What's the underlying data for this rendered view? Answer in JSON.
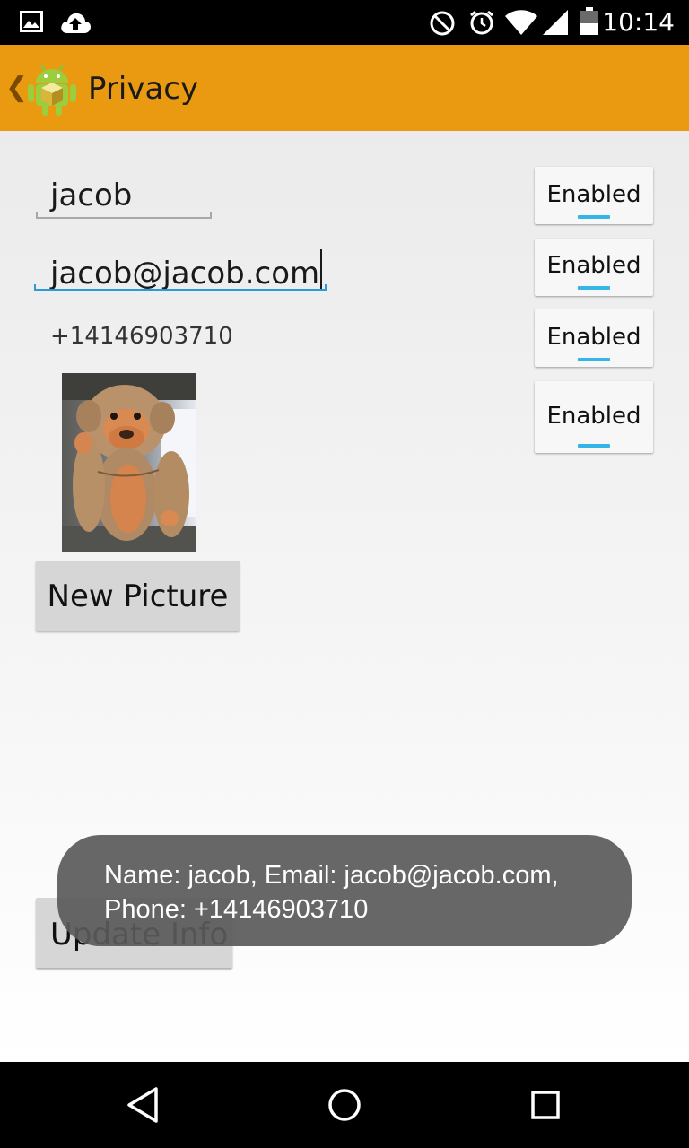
{
  "status_bar": {
    "time": "10:14",
    "icons": [
      "image-icon",
      "cloud-upload-icon",
      "do-not-disturb-icon",
      "alarm-icon",
      "wifi-icon",
      "signal-icon",
      "battery-icon"
    ]
  },
  "action_bar": {
    "title": "Privacy",
    "icon": "android-app-icon",
    "background": "#ea9a10"
  },
  "form": {
    "name_value": "jacob",
    "email_value": "jacob@jacob.com",
    "phone_value": "+14146903710",
    "toggles": [
      {
        "label": "Enabled",
        "state": "on"
      },
      {
        "label": "Enabled",
        "state": "on"
      },
      {
        "label": "Enabled",
        "state": "on"
      },
      {
        "label": "Enabled",
        "state": "on"
      }
    ],
    "new_picture_label": "New Picture",
    "update_info_label": "Update Info"
  },
  "toast": {
    "line1": "Name: jacob, Email: jacob@jacob.com,",
    "line2": "Phone: +14146903710"
  },
  "nav_bar": {
    "icons": [
      "back-icon",
      "home-icon",
      "recents-icon"
    ]
  },
  "colors": {
    "accent": "#33b5e5",
    "focus_underline": "#2a9bd6"
  }
}
